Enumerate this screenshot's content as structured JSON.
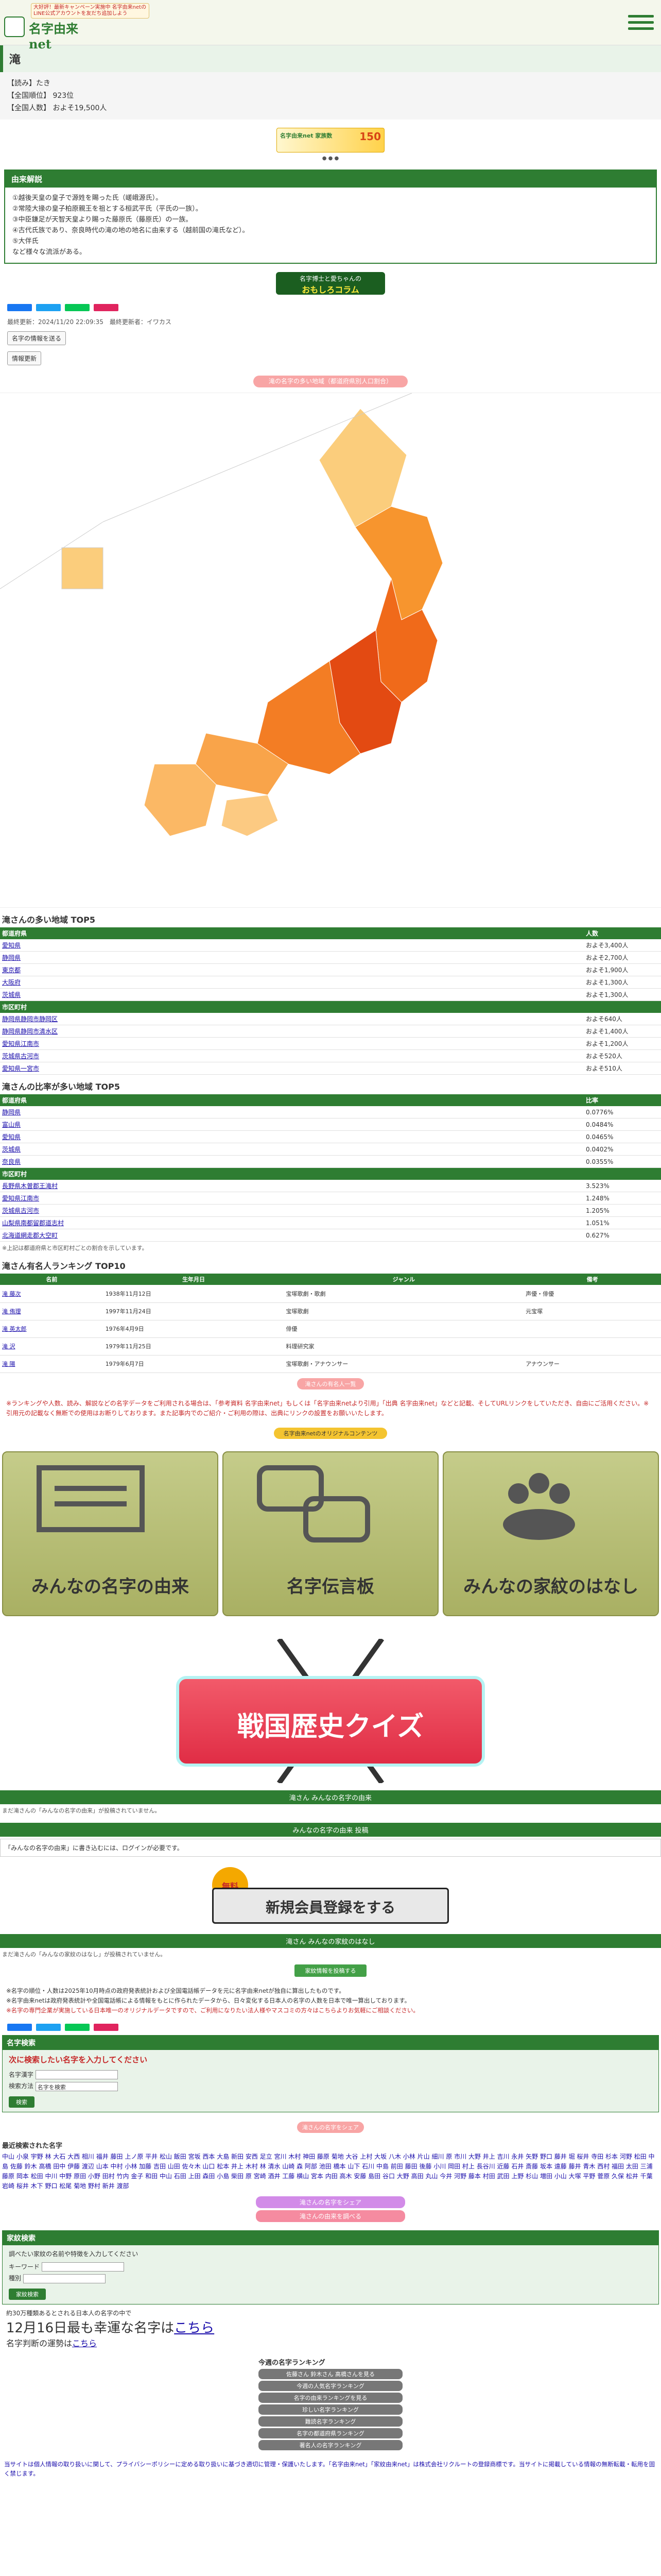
{
  "header": {
    "logo_text": "名字由来net",
    "promo": "大好評！最新キャンペーン実施中 名字由来netのLINE公式アカウントを友だち追加しよう"
  },
  "surname": {
    "title": "滝",
    "reading_label": "【読み】たき",
    "rank_label": "【全国順位】 923位",
    "count_label": "【全国人数】 およそ19,500人"
  },
  "ad": {
    "left": "名字由来net 家族数",
    "right": "150"
  },
  "origin": {
    "header": "由来解説",
    "items": [
      "①越後天皇の皇子で源姓を賜った氏（嵯峨源氏）。",
      "②常陸大掾の皇子柏原親王を祖とする桓武平氏（平氏の一族）。",
      "③中臣鎌足が天智天皇より賜った藤原氏（藤原氏）の一族。",
      "④古代氏族であり、奈良時代の滝の地の地名に由来する（越前国の滝氏など）。",
      "⑤大伴氏",
      "など様々な流派がある。"
    ]
  },
  "mini_banner": {
    "top": "名字博士と愛ちゃんの",
    "big": "おもしろコラム"
  },
  "meta": {
    "updated": "最終更新：2024/11/20 22:09:35　最終更新者：イワカス"
  },
  "buttons": {
    "rename": "名字の情報を送る",
    "report": "情報更新"
  },
  "map": {
    "caption": "滝の名字の多い地域（都道府県別人口割合）"
  },
  "rank_pref": {
    "heading": "滝さんの多い地域 TOP5",
    "pref_header": "都道府県",
    "pref_value_header": "人数",
    "prefs": [
      [
        "愛知県",
        "およそ3,400人"
      ],
      [
        "静岡県",
        "およそ2,700人"
      ],
      [
        "東京都",
        "およそ1,900人"
      ],
      [
        "大阪府",
        "およそ1,300人"
      ],
      [
        "茨城県",
        "およそ1,300人"
      ]
    ],
    "city_header": "市区町村",
    "cities": [
      [
        "静岡県静岡市静岡区",
        "およそ640人"
      ],
      [
        "静岡県静岡市清水区",
        "およそ1,400人"
      ],
      [
        "愛知県江南市",
        "およそ1,200人"
      ],
      [
        "茨城県古河市",
        "およそ520人"
      ],
      [
        "愛知県一宮市",
        "およそ510人"
      ]
    ]
  },
  "rank_ratio": {
    "heading": "滝さんの比率が多い地域 TOP5",
    "pref_header": "都道府県",
    "pref_value_header": "比率",
    "prefs": [
      [
        "静岡県",
        "0.0776%"
      ],
      [
        "富山県",
        "0.0484%"
      ],
      [
        "愛知県",
        "0.0465%"
      ],
      [
        "茨城県",
        "0.0402%"
      ],
      [
        "奈良県",
        "0.0355%"
      ]
    ],
    "city_header": "市区町村",
    "cities": [
      [
        "長野県木曽郡王滝村",
        "3.523%"
      ],
      [
        "愛知県江南市",
        "1.248%"
      ],
      [
        "茨城県古河市",
        "1.205%"
      ],
      [
        "山梨県南都留郡道志村",
        "1.051%"
      ],
      [
        "北海道網走郡大空町",
        "0.627%"
      ]
    ],
    "note": "※上記は都道府県と市区町村ごとの割合を示しています。"
  },
  "famous": {
    "heading": "滝さん有名人ランキング TOP10",
    "headers": [
      "名前",
      "生年月日",
      "ジャンル",
      "備考"
    ],
    "rows": [
      [
        "滝 藤次",
        "1938年11月12日",
        "宝塚歌劇・歌劇",
        "声優・俳優"
      ],
      [
        "滝 侑理",
        "1997年11月24日",
        "宝塚歌劇",
        "元宝塚"
      ],
      [
        "滝 英太郎",
        "1976年4月9日",
        "俳優",
        ""
      ],
      [
        "滝 沢",
        "1979年11月25日",
        "料理研究家",
        ""
      ],
      [
        "滝 陽",
        "1979年6月7日",
        "宝塚歌劇・アナウンサー",
        "アナウンサー"
      ]
    ],
    "more_button": "滝さんの有名人一覧"
  },
  "notice": "※ランキングや人数、読み、解説などの名字データをご利用される場合は、「参考資料 名字由来net」もしくは「名字由来netより引用」「出典 名字由来net」などと記載、そしてURLリンクをしていただき、自由にご活用ください。※引用元の記載なく無断での使用はお断りしております。また記事内でのご紹介・ご利用の際は、出典にリンクの設置をお願いいたします。",
  "tiles": {
    "heading": "名字由来netのオリジナルコンテンツ",
    "items": [
      "みんなの名字の由来",
      "名字伝言板",
      "みんなの家紋のはなし"
    ]
  },
  "quiz": {
    "label": "戦国歴史クイズ"
  },
  "posts": {
    "strip1": "滝さん みんなの名字の由来",
    "line1": "まだ滝さんの「みんなの名字の由来」が投稿されていません。",
    "strip2": "みんなの名字の由来 投稿",
    "box_text": "「みんなの名字の由来」に書き込むには、ログインが必要です。",
    "register_badge": "無料",
    "register_label": "新規会員登録をする",
    "strip3": "滝さん みんなの家紋のはなし",
    "line2": "まだ滝さんの「みんなの家紋のはなし」が投稿されていません。",
    "post_button": "家紋情報を投稿する"
  },
  "footnote": {
    "p1": "※名字の順位・人数は2025年10月時点の政府発表統計および全国電話帳データを元に名字由来netが独自に算出したものです。",
    "p2": "※名字由来netは政府発表統計や全国電話帳による情報をもとに作られたデータから、日々変化する日本人の名字の人数を日本で唯一算出しております。",
    "red": "※名字の専門企業が実施している日本唯一のオリジナルデータですので、ご利用になりたい法人様やマスコミの方々はこちらよりお気軽にご相談ください。"
  },
  "search": {
    "header": "名字検索",
    "sub": "次に検索したい名字を入力してください",
    "field_label": "名字漢字",
    "type_label": "検索方法",
    "type_value": "名字を検索",
    "button": "検索"
  },
  "recent": {
    "title": "最近検索された名字",
    "names": "中山 小泉 宇野 林 大石 大西 相川 福井 藤田 上ノ原 平井 松山 飯田 宮坂 西本 大島 新田 安西 足立 宮川 木村 神田 藤原 菊地 大谷 上村 大坂 八木 小林 片山 細川 原 市川 大野 井上 吉川 永井 矢野 野口 藤井 堀 桜井 寺田 杉本 河野 松田 中島 佐藤 鈴木 高橋 田中 伊藤 渡辺 山本 中村 小林 加藤 吉田 山田 佐々木 山口 松本 井上 木村 林 清水 山崎 森 阿部 池田 橋本 山下 石川 中島 前田 藤田 後藤 小川 岡田 村上 長谷川 近藤 石井 斎藤 坂本 遠藤 藤井 青木 西村 福田 太田 三浦 藤原 岡本 松田 中川 中野 原田 小野 田村 竹内 金子 和田 中山 石田 上田 森田 小島 柴田 原 宮崎 酒井 工藤 横山 宮本 内田 高木 安藤 島田 谷口 大野 高田 丸山 今井 河野 藤本 村田 武田 上野 杉山 増田 小山 大塚 平野 菅原 久保 松井 千葉 岩崎 桜井 木下 野口 松尾 菊地 野村 新井 渡部"
  },
  "pink_stack": [
    "滝さんの名字をシェア",
    "滝さんの由来を調べる"
  ],
  "family": {
    "header": "家紋検索",
    "sub": "調べたい家紋の名前や特徴を入力してください",
    "kw_label": "キーワード",
    "type_label": "種別",
    "button": "家紋検索"
  },
  "lucky": {
    "pre": "約30万種類あるとされる日本人の名字の中で",
    "date": "12月16日最も幸運な名字は",
    "link": "こちら",
    "tail": "名字判断の運勢は",
    "tail_link": "こちら"
  },
  "side_rank": {
    "title": "今週の名字ランキング",
    "items": [
      "佐藤さん 鈴木さん 高橋さんを見る",
      "今週の人気名字ランキング",
      "名字の由来ランキングを見る",
      "珍しい名字ランキング",
      "難読名字ランキング",
      "名字の都道府県ランキング",
      "著名人の名字ランキング"
    ]
  },
  "bottom_text": "当サイトは個人情報の取り扱いに関して、プライバシーポリシーに定める取り扱いに基づき適切に管理・保護いたします。「名字由来net」「家紋由来net」は株式会社リクルートの登録商標です。当サイトに掲載している情報の無断転載・転用を固く禁じます。"
}
